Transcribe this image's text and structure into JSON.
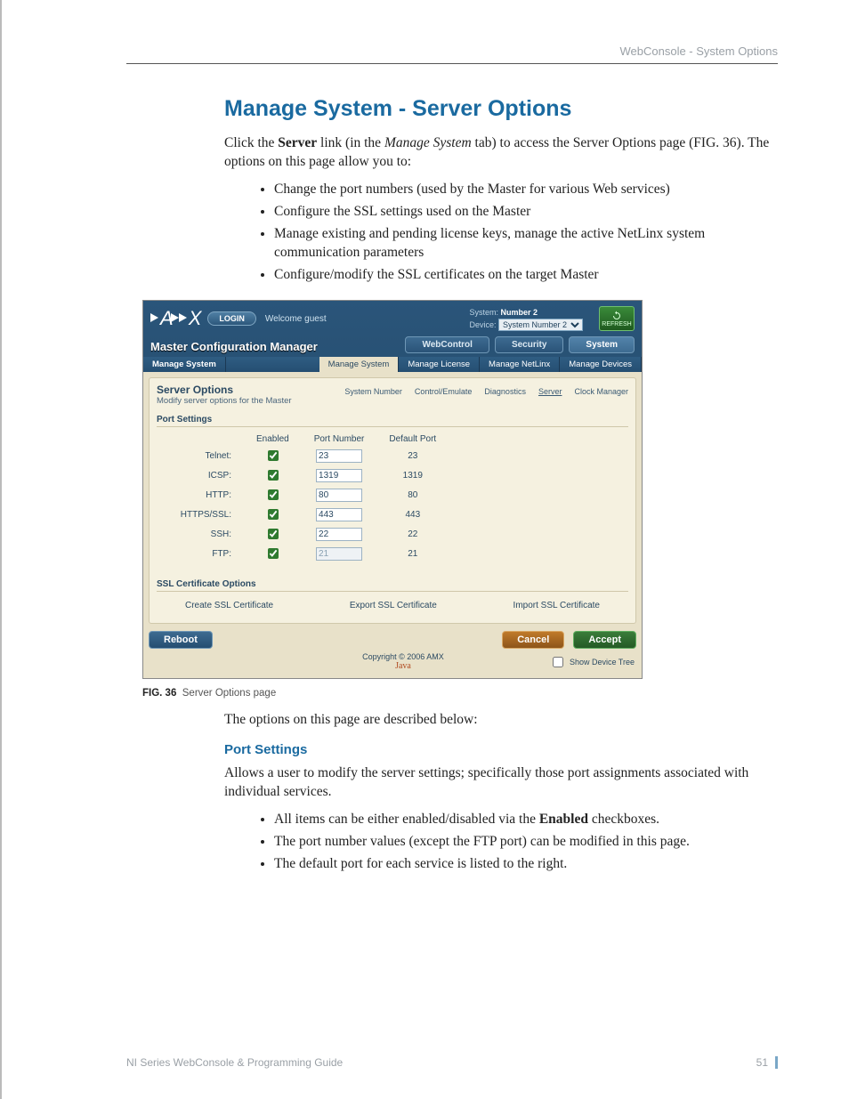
{
  "running_head": "WebConsole - System Options",
  "title": "Manage System - Server Options",
  "intro_1a": "Click the ",
  "intro_1b": "Server",
  "intro_1c": " link (in the ",
  "intro_1d": "Manage System",
  "intro_1e": " tab) to access the Server Options page (FIG. 36). The options on this page allow you to:",
  "intro_bullets": [
    "Change the port numbers (used by the Master for various Web services)",
    "Configure the SSL settings used on the Master",
    "Manage existing and pending license keys, manage the active NetLinx system communication parameters",
    "Configure/modify the SSL certificates on the target Master"
  ],
  "ui": {
    "login": "LOGIN",
    "welcome": "Welcome guest",
    "sys_label": "System:",
    "sys_value": "Number 2",
    "dev_label": "Device:",
    "dev_value": "System Number 2",
    "refresh": "REFRESH",
    "mcm": "Master Configuration Manager",
    "main_tabs": [
      "WebControl",
      "Security",
      "System"
    ],
    "bar_left": "Manage System",
    "bar_tabs": [
      "Manage System",
      "Manage License",
      "Manage NetLinx",
      "Manage Devices"
    ],
    "so_title": "Server Options",
    "so_sub": "Modify server options for the Master",
    "subnav": [
      "System Number",
      "Control/Emulate",
      "Diagnostics",
      "Server",
      "Clock Manager"
    ],
    "sect_port": "Port Settings",
    "col_enabled": "Enabled",
    "col_portnum": "Port Number",
    "col_default": "Default Port",
    "rows": [
      {
        "name": "Telnet:",
        "en": true,
        "val": "23",
        "def": "23",
        "dis": false
      },
      {
        "name": "ICSP:",
        "en": true,
        "val": "1319",
        "def": "1319",
        "dis": false
      },
      {
        "name": "HTTP:",
        "en": true,
        "val": "80",
        "def": "80",
        "dis": false
      },
      {
        "name": "HTTPS/SSL:",
        "en": true,
        "val": "443",
        "def": "443",
        "dis": false
      },
      {
        "name": "SSH:",
        "en": true,
        "val": "22",
        "def": "22",
        "dis": false
      },
      {
        "name": "FTP:",
        "en": true,
        "val": "21",
        "def": "21",
        "dis": true
      }
    ],
    "sect_ssl": "SSL Certificate Options",
    "ssl_links": [
      "Create SSL Certificate",
      "Export SSL Certificate",
      "Import SSL Certificate"
    ],
    "btn_reboot": "Reboot",
    "btn_cancel": "Cancel",
    "btn_accept": "Accept",
    "copyright": "Copyright © 2006 AMX",
    "java": "Java",
    "show_tree": "Show Device Tree"
  },
  "fig_label": "FIG. 36",
  "fig_text": "Server Options page",
  "after_fig": "The options on this page are described below:",
  "subhead_port": "Port Settings",
  "port_para": "Allows a user to modify the server settings; specifically those port assignments associated with individual services.",
  "port_bullets_a1": "All items can be either enabled/disabled via the ",
  "port_bullets_a2": "Enabled",
  "port_bullets_a3": " checkboxes.",
  "port_bullets_b": "The port number values (except the FTP port) can be modified in this page.",
  "port_bullets_c": "The default port for each service is listed to the right.",
  "footer_left": "NI Series WebConsole & Programming Guide",
  "footer_right": "51"
}
